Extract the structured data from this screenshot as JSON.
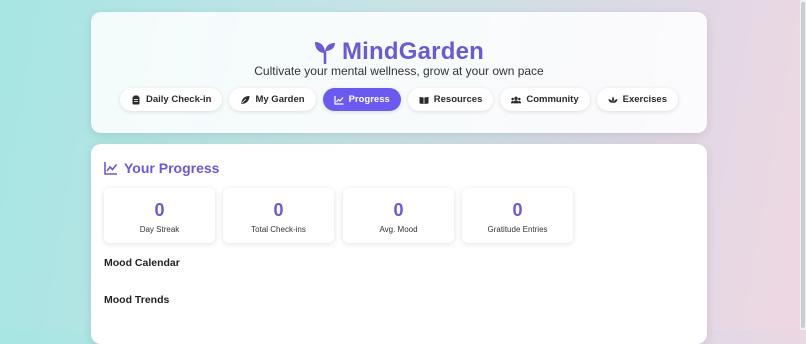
{
  "app": {
    "name": "MindGarden",
    "tagline": "Cultivate your mental wellness, grow at your own pace",
    "accent": "#6a5af0"
  },
  "nav": {
    "tabs": [
      {
        "label": "Daily Check-in",
        "icon": "clipboard-icon",
        "active": false
      },
      {
        "label": "My Garden",
        "icon": "leaf-icon",
        "active": false
      },
      {
        "label": "Progress",
        "icon": "chart-line-icon",
        "active": true
      },
      {
        "label": "Resources",
        "icon": "book-icon",
        "active": false
      },
      {
        "label": "Community",
        "icon": "users-icon",
        "active": false
      },
      {
        "label": "Exercises",
        "icon": "lotus-icon",
        "active": false
      }
    ]
  },
  "progress": {
    "title": "Your Progress",
    "stats": [
      {
        "value": "0",
        "label": "Day Streak"
      },
      {
        "value": "0",
        "label": "Total Check-ins"
      },
      {
        "value": "0",
        "label": "Avg. Mood"
      },
      {
        "value": "0",
        "label": "Gratitude Entries"
      }
    ],
    "mood_calendar_title": "Mood Calendar",
    "mood_trends_title": "Mood Trends"
  }
}
